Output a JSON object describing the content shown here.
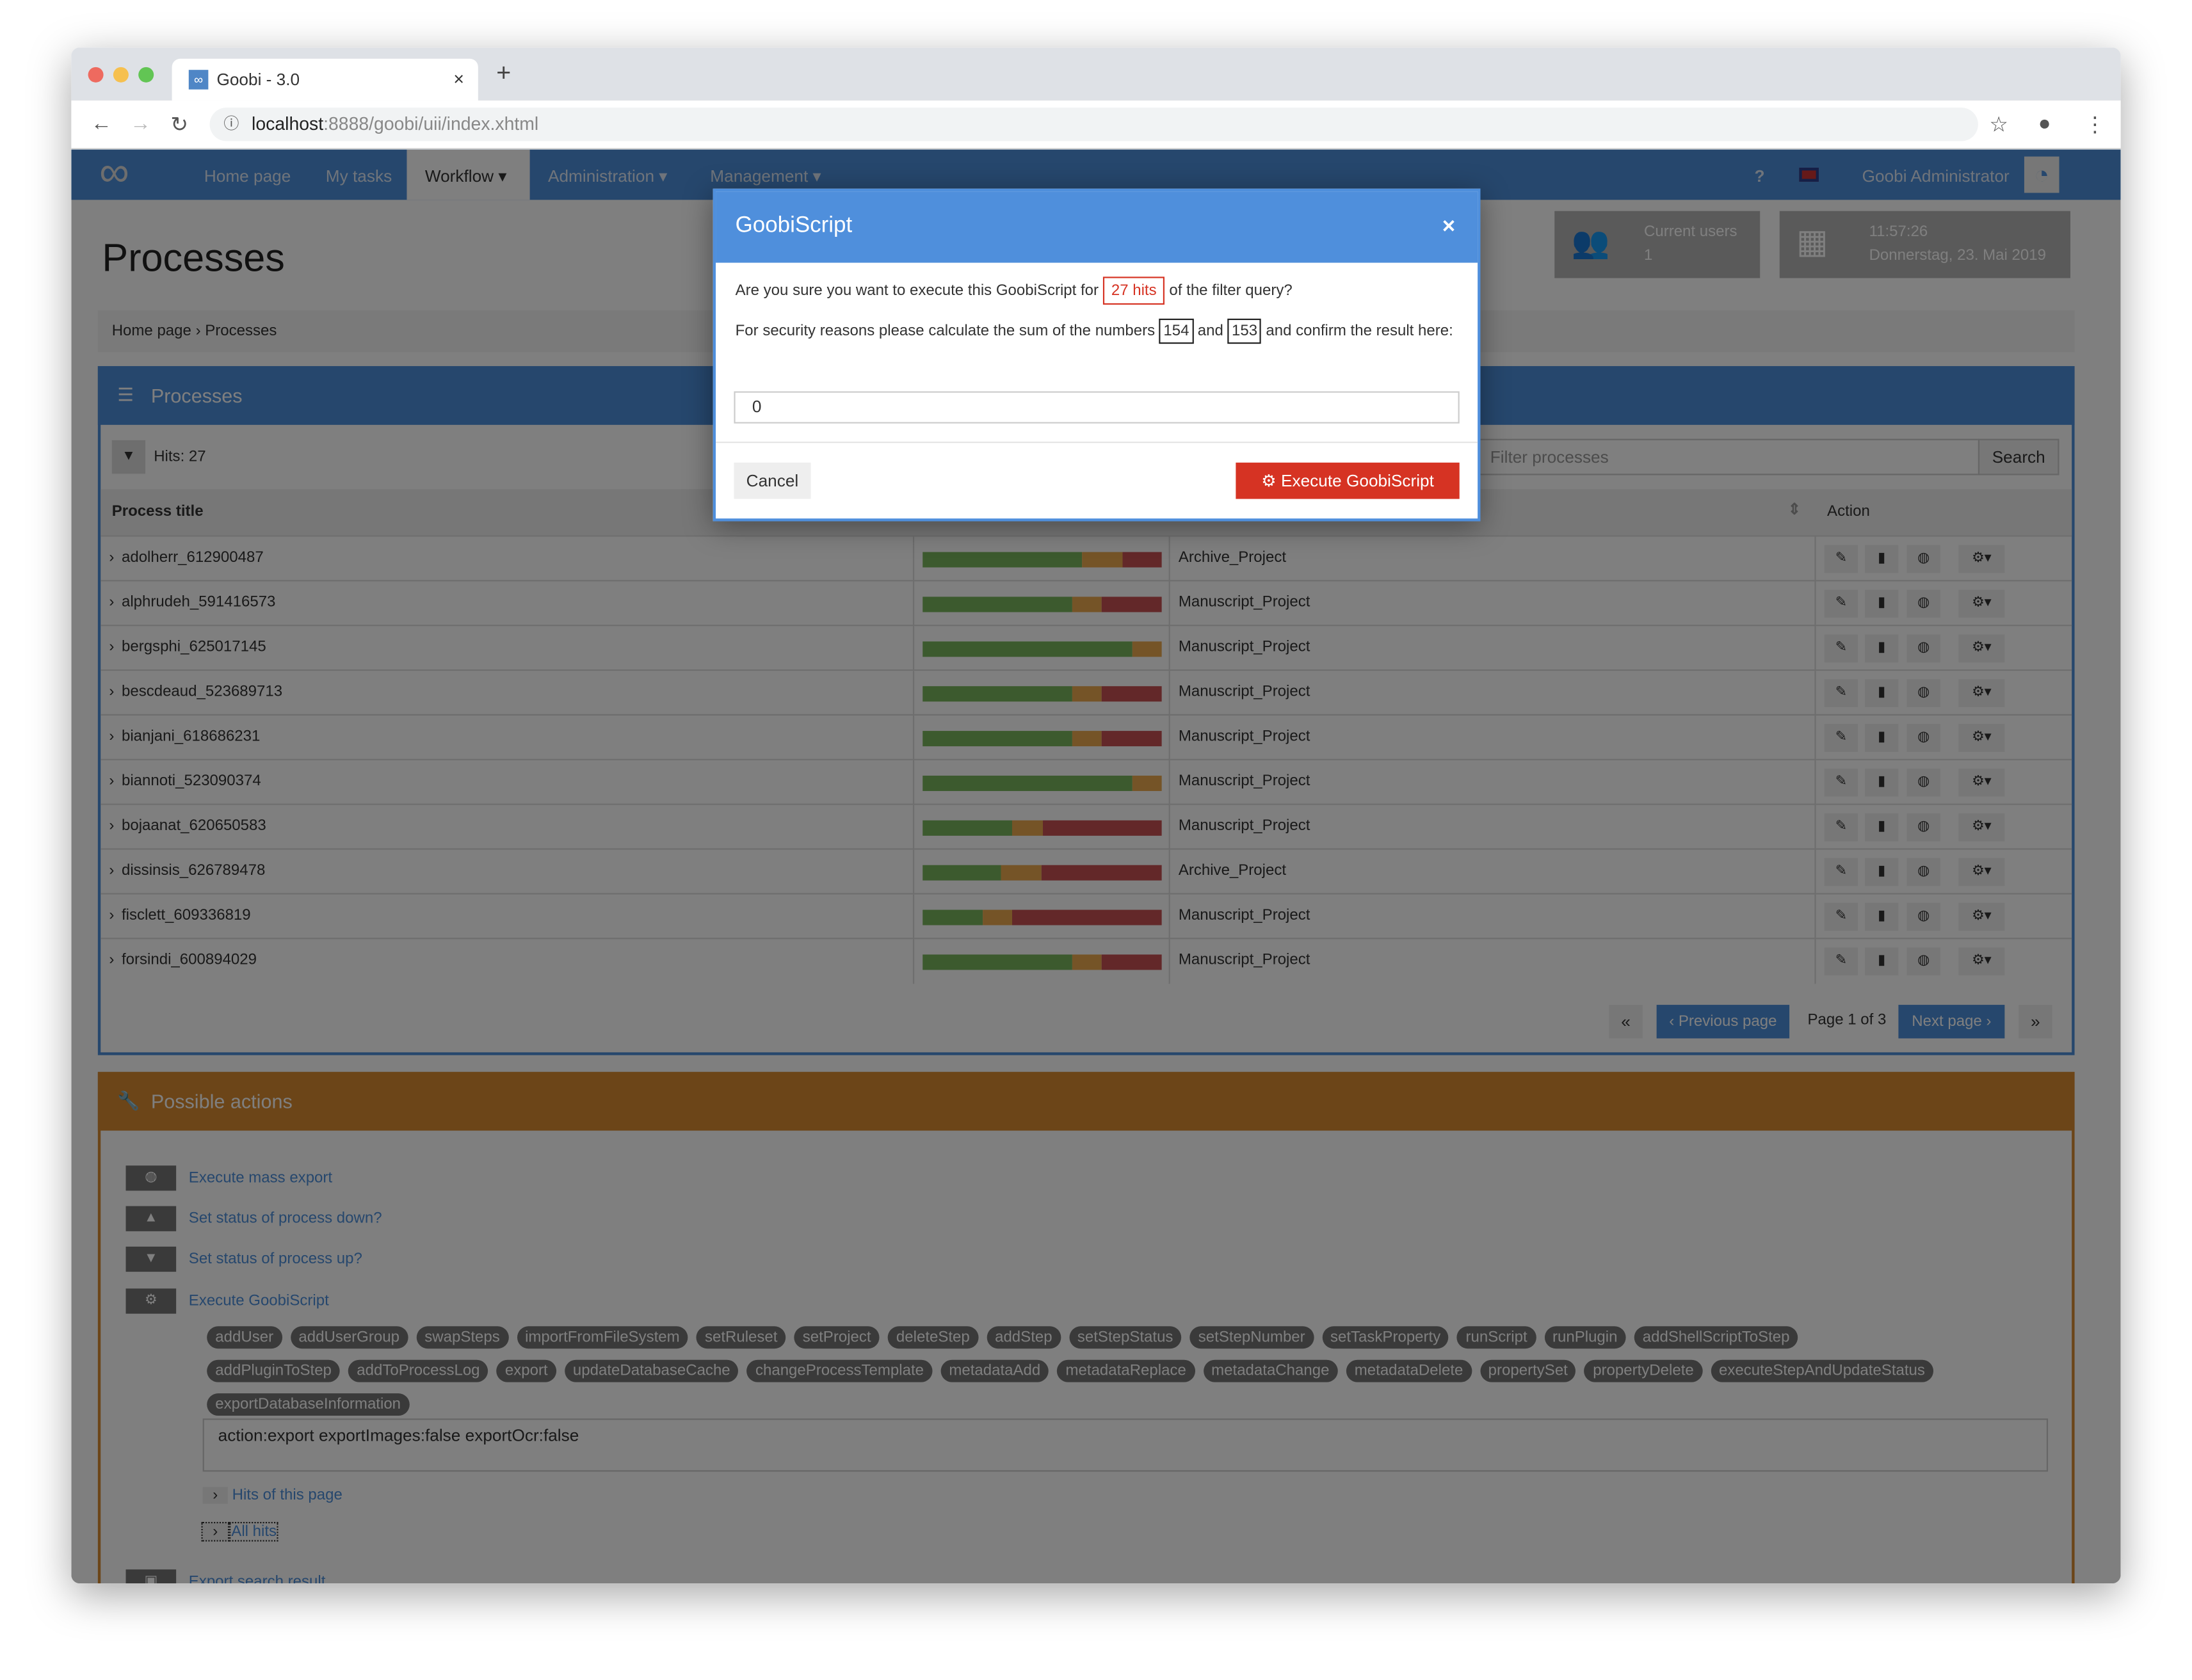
{
  "browser": {
    "tab_title": "Goobi - 3.0",
    "url_host": "localhost",
    "url_rest": ":8888/goobi/uii/index.xhtml"
  },
  "navbar": {
    "items": [
      "Home page",
      "My tasks",
      "Workflow",
      "Administration",
      "Management"
    ],
    "active": "Workflow",
    "help": "?",
    "user": "Goobi Administrator"
  },
  "header": {
    "title": "Processes",
    "current_users_label": "Current users",
    "current_users_count": "1",
    "time": "11:57:26",
    "date": "Donnerstag, 23. Mai 2019"
  },
  "breadcrumb": [
    "Home page",
    "Processes"
  ],
  "processes": {
    "panel_title": "Processes",
    "hits": "Hits: 27",
    "filter_placeholder": "Filter processes",
    "search_label": "Search",
    "columns": {
      "title": "Process title",
      "action": "Action"
    },
    "rows": [
      {
        "title": "adolherr_612900487",
        "project": "Archive_Project",
        "progress": [
          0.667,
          0.168,
          0.165
        ]
      },
      {
        "title": "alphrudeh_591416573",
        "project": "Manuscript_Project",
        "progress": [
          0.626,
          0.122,
          0.252
        ]
      },
      {
        "title": "bergsphi_625017145",
        "project": "Manuscript_Project",
        "progress": [
          0.875,
          0.125,
          0
        ]
      },
      {
        "title": "bescdeaud_523689713",
        "project": "Manuscript_Project",
        "progress": [
          0.626,
          0.122,
          0.252
        ]
      },
      {
        "title": "bianjani_618686231",
        "project": "Manuscript_Project",
        "progress": [
          0.626,
          0.122,
          0.252
        ]
      },
      {
        "title": "biannoti_523090374",
        "project": "Manuscript_Project",
        "progress": [
          0.875,
          0.125,
          0
        ]
      },
      {
        "title": "bojaanat_620650583",
        "project": "Manuscript_Project",
        "progress": [
          0.374,
          0.128,
          0.498
        ]
      },
      {
        "title": "dissinsis_626789478",
        "project": "Archive_Project",
        "progress": [
          0.33,
          0.165,
          0.505
        ]
      },
      {
        "title": "fisclett_609336819",
        "project": "Manuscript_Project",
        "progress": [
          0.252,
          0.122,
          0.626
        ]
      },
      {
        "title": "forsindi_600894029",
        "project": "Manuscript_Project",
        "progress": [
          0.626,
          0.122,
          0.252
        ]
      }
    ],
    "pagination": {
      "first": "«",
      "prev": "‹ Previous page",
      "page": "Page 1 of 3",
      "next": "Next page ›",
      "last": "»"
    }
  },
  "actions": {
    "panel_title": "Possible actions",
    "items": [
      "Execute mass export",
      "Set status of process down?",
      "Set status of process up?",
      "Execute GoobiScript"
    ],
    "tags": [
      "addUser",
      "addUserGroup",
      "swapSteps",
      "importFromFileSystem",
      "setRuleset",
      "setProject",
      "deleteStep",
      "addStep",
      "setStepStatus",
      "setStepNumber",
      "setTaskProperty",
      "runScript",
      "runPlugin",
      "addShellScriptToStep",
      "addPluginToStep",
      "addToProcessLog",
      "export",
      "updateDatabaseCache",
      "changeProcessTemplate",
      "metadataAdd",
      "metadataReplace",
      "metadataChange",
      "metadataDelete",
      "propertySet",
      "propertyDelete",
      "executeStepAndUpdateStatus",
      "exportDatabaseInformation"
    ],
    "script": "action:export exportImages:false exportOcr:false",
    "hits_page": "Hits of this page",
    "all_hits": "All hits",
    "export_result": "Export search result"
  },
  "modal": {
    "title": "GoobiScript",
    "q1_pre": "Are you sure you want to execute this GoobiScript for",
    "q1_hits": "27 hits",
    "q1_post": "of the filter query?",
    "q2_pre": "For security reasons please calculate the sum of the numbers",
    "n1": "154",
    "and": "and",
    "n2": "153",
    "q2_post": "and confirm the result here:",
    "input_value": "0",
    "cancel": "Cancel",
    "execute": "Execute GoobiScript"
  },
  "colors": {
    "primary": "#4c8eda",
    "danger": "#d63323",
    "warning": "#d88a30",
    "green": "#78b45c",
    "orange": "#eba94e",
    "red": "#c75152"
  }
}
